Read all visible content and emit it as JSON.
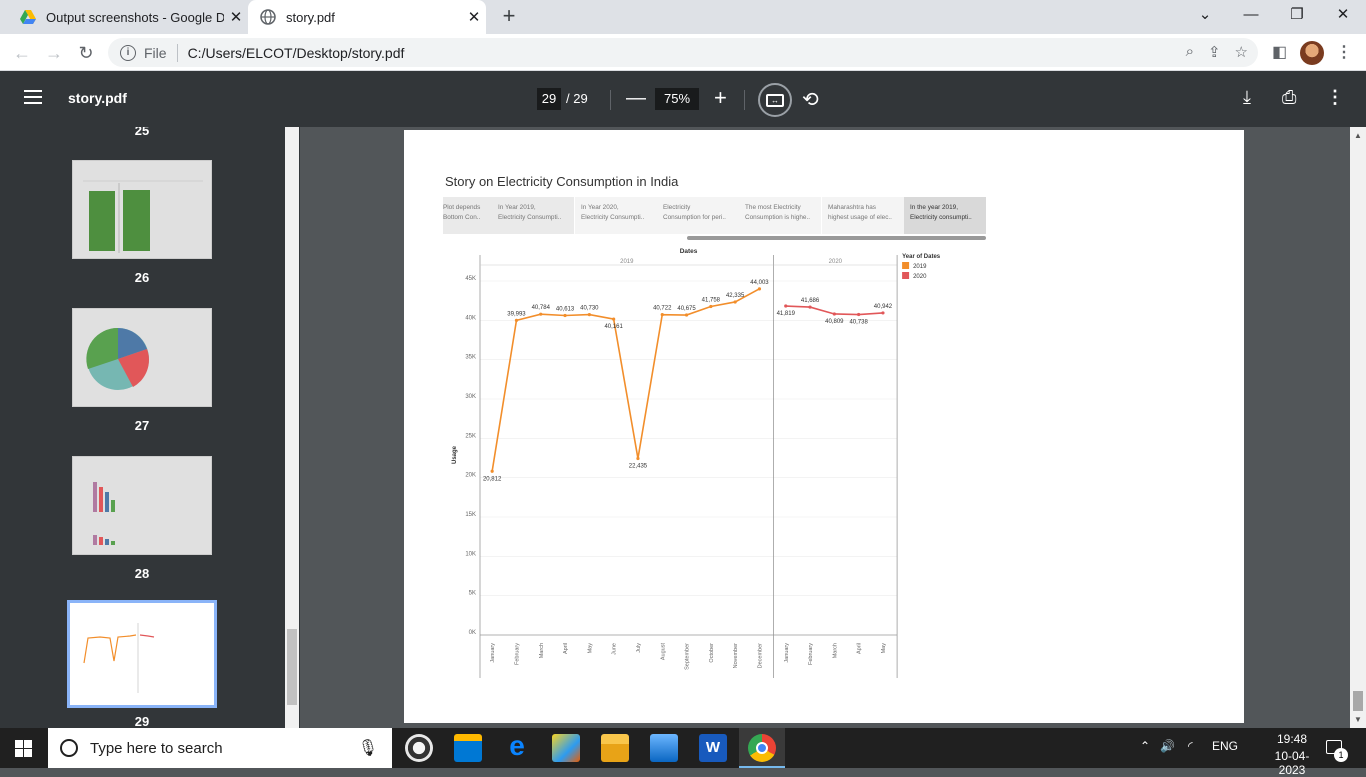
{
  "browser": {
    "tabs": [
      {
        "label": "Output screenshots - Google Dri",
        "icon": "google-drive-icon"
      },
      {
        "label": "story.pdf",
        "icon": "globe-icon"
      }
    ],
    "address": {
      "prefix": "File",
      "url": "C:/Users/ELCOT/Desktop/story.pdf"
    }
  },
  "viewer": {
    "title": "story.pdf",
    "page": "29",
    "total": "/ 29",
    "zoom": "75%"
  },
  "sidebar": {
    "numbers": [
      "25",
      "26",
      "27",
      "28",
      "29"
    ]
  },
  "story": {
    "title": "Story on Electricity Consumption in India",
    "points": [
      {
        "l1": "Plot depends",
        "l2": "Bottom Con.."
      },
      {
        "l1": "In Year 2019,",
        "l2": "Electricity Consumpti.."
      },
      {
        "l1": "In Year 2020,",
        "l2": "Electricity Consumpti.."
      },
      {
        "l1": "Electricity",
        "l2": "Consumption for peri.."
      },
      {
        "l1": "The most Electricity",
        "l2": "Consumption is highe.."
      },
      {
        "l1": "Maharashtra has",
        "l2": "highest usage of elec.."
      },
      {
        "l1": "In the year 2019,",
        "l2": "Electricity consumpti.."
      }
    ]
  },
  "chart_data": {
    "type": "line",
    "title": "Dates",
    "ylabel": "Usage",
    "ylim": [
      0,
      45000
    ],
    "yticks": [
      "0K",
      "5K",
      "10K",
      "15K",
      "20K",
      "25K",
      "30K",
      "35K",
      "40K",
      "45K"
    ],
    "panels": [
      {
        "label": "2019",
        "color": "#f28e2b",
        "x": [
          "January",
          "February",
          "March",
          "April",
          "May",
          "June",
          "July",
          "August",
          "September",
          "October",
          "November",
          "December"
        ],
        "values": [
          20812,
          39993,
          40784,
          40613,
          40730,
          40161,
          22435,
          40722,
          40675,
          41758,
          42335,
          44003
        ],
        "labels": [
          "20,812",
          "39,993",
          "40,784",
          "40,613",
          "40,730",
          "40,161",
          "22,435",
          "40,722",
          "40,675",
          "41,758",
          "42,335",
          "44,003"
        ]
      },
      {
        "label": "2020",
        "color": "#e15759",
        "x": [
          "January",
          "February",
          "March",
          "April",
          "May"
        ],
        "values": [
          41819,
          41686,
          40809,
          40738,
          40942
        ],
        "labels": [
          "41,819",
          "41,686",
          "40,809",
          "40,738",
          "40,942"
        ]
      }
    ],
    "legend": {
      "title": "Year of Dates",
      "items": [
        {
          "name": "2019",
          "color": "#f28e2b"
        },
        {
          "name": "2020",
          "color": "#e15759"
        }
      ]
    }
  },
  "taskbar": {
    "search_placeholder": "Type here to search",
    "lang": "ENG",
    "time": "19:48",
    "date": "10-04-2023",
    "notif": "1"
  }
}
